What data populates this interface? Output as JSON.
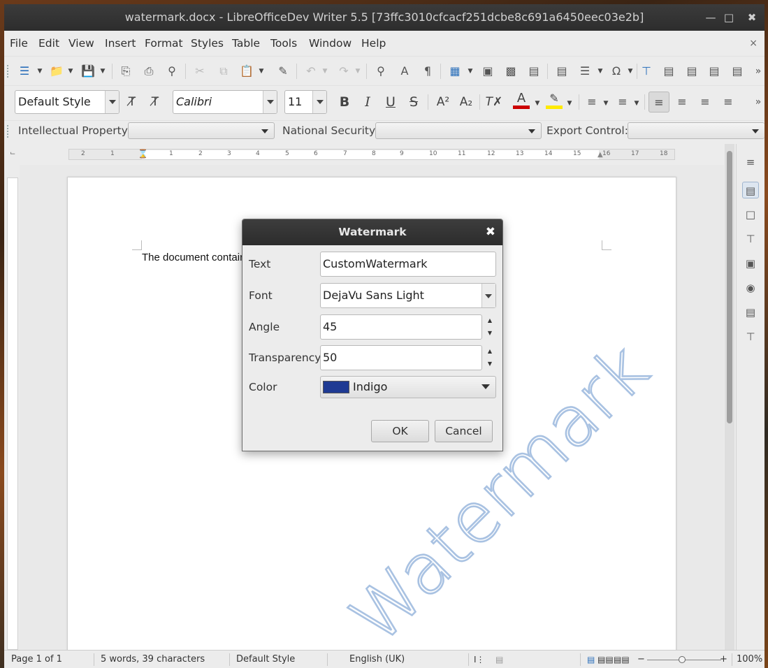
{
  "window": {
    "title": "watermark.docx - LibreOfficeDev Writer 5.5 [73ffc3010cfcacf251dcbe8c691a6450eec03e2b]"
  },
  "menubar": {
    "items": [
      "File",
      "Edit",
      "View",
      "Insert",
      "Format",
      "Styles",
      "Table",
      "Tools",
      "Window",
      "Help"
    ],
    "close_glyph": "×"
  },
  "formatting": {
    "paragraph_style": "Default Style",
    "font_name": "Calibri",
    "font_size": "11",
    "bold": "B",
    "italic": "I",
    "underline": "U",
    "strikethrough": "S"
  },
  "infobar": {
    "intellectual_property_label": "Intellectual Property:",
    "national_security_label": "National Security:",
    "export_control_label": "Export Control:"
  },
  "ruler": {
    "numbers": [
      "2",
      "1",
      "1",
      "2",
      "3",
      "4",
      "5",
      "6",
      "7",
      "8",
      "9",
      "10",
      "11",
      "12",
      "13",
      "14",
      "15",
      "16",
      "17",
      "18"
    ]
  },
  "document": {
    "text": "The document contair",
    "watermark_text": "Watermark",
    "watermark_color": "#a9c2e2"
  },
  "dialog": {
    "title": "Watermark",
    "close_glyph": "✖",
    "text_label": "Text",
    "text_value": "CustomWatermark",
    "font_label": "Font",
    "font_value": "DejaVu Sans Light",
    "angle_label": "Angle",
    "angle_value": "45",
    "transparency_label": "Transparency",
    "transparency_value": "50",
    "color_label": "Color",
    "color_value": "Indigo",
    "color_swatch": "#1f3a93",
    "ok_label": "OK",
    "cancel_label": "Cancel"
  },
  "statusbar": {
    "page": "Page 1 of 1",
    "word_count": "5 words, 39 characters",
    "page_style": "Default Style",
    "language": "English (UK)",
    "zoom": "100%"
  },
  "colors": {
    "accent_blue": "#2a6fba",
    "font_color_red": "#cc0000",
    "highlight_yellow": "#ffea00"
  }
}
